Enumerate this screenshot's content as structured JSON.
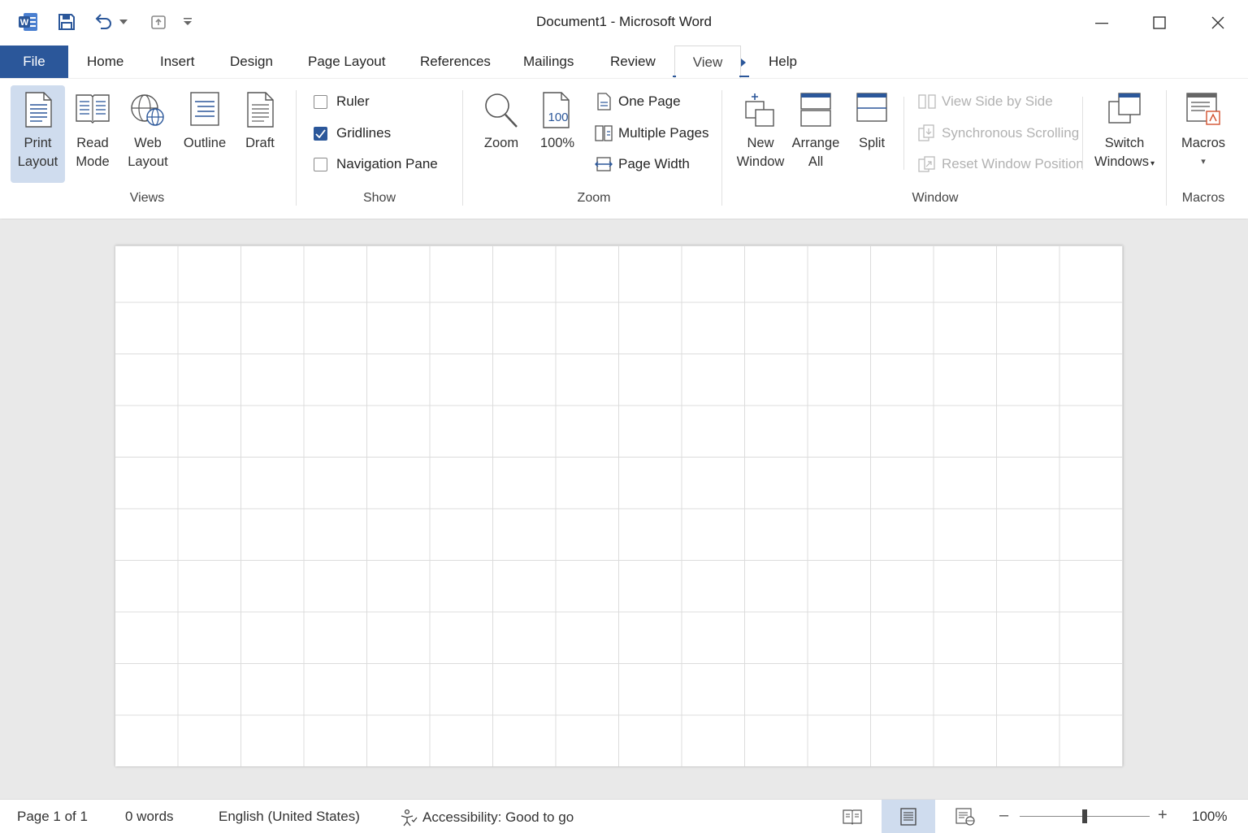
{
  "window": {
    "title": "Document1  -  Microsoft Word",
    "app_icon": "word-icon",
    "qat": [
      "save-icon",
      "undo-icon",
      "repeat-icon",
      "customize-qat-icon"
    ]
  },
  "tabs": [
    "File",
    "Home",
    "Insert",
    "Design",
    "Page Layout",
    "References",
    "Mailings",
    "Review",
    "View",
    "Help"
  ],
  "active_tab": "View",
  "ribbon": {
    "views": {
      "label": "Views",
      "print_layout": [
        "Print",
        "Layout"
      ],
      "read_mode": [
        "Read",
        "Mode"
      ],
      "web_layout": [
        "Web",
        "Layout"
      ],
      "outline": "Outline",
      "draft": "Draft"
    },
    "show": {
      "label": "Show",
      "ruler": "Ruler",
      "gridlines": "Gridlines",
      "navigation_pane": "Navigation Pane",
      "gridlines_checked": true,
      "ruler_checked": false,
      "navigation_pane_checked": false
    },
    "zoom": {
      "label": "Zoom",
      "zoom": "Zoom",
      "hundred": "100%",
      "one_page": "One Page",
      "multiple_pages": "Multiple Pages",
      "page_width": "Page Width"
    },
    "window": {
      "label": "Window",
      "new_window": [
        "New",
        "Window"
      ],
      "arrange_all": [
        "Arrange",
        "All"
      ],
      "split": "Split",
      "view_side_by_side": "View Side by Side",
      "synchronous_scrolling": "Synchronous Scrolling",
      "reset_window_position": "Reset Window Position",
      "switch_windows": [
        "Switch",
        "Windows"
      ]
    },
    "macros": {
      "label": "Macros",
      "macros": "Macros"
    }
  },
  "status": {
    "page": "Page 1 of 1",
    "words": "0 words",
    "language": "English (United States)",
    "accessibility": "Accessibility: Good to go",
    "zoom": "100%",
    "zoom_level": 0.5
  },
  "colors": {
    "accent": "#2b579a",
    "selected_bg": "#cfdcee"
  }
}
